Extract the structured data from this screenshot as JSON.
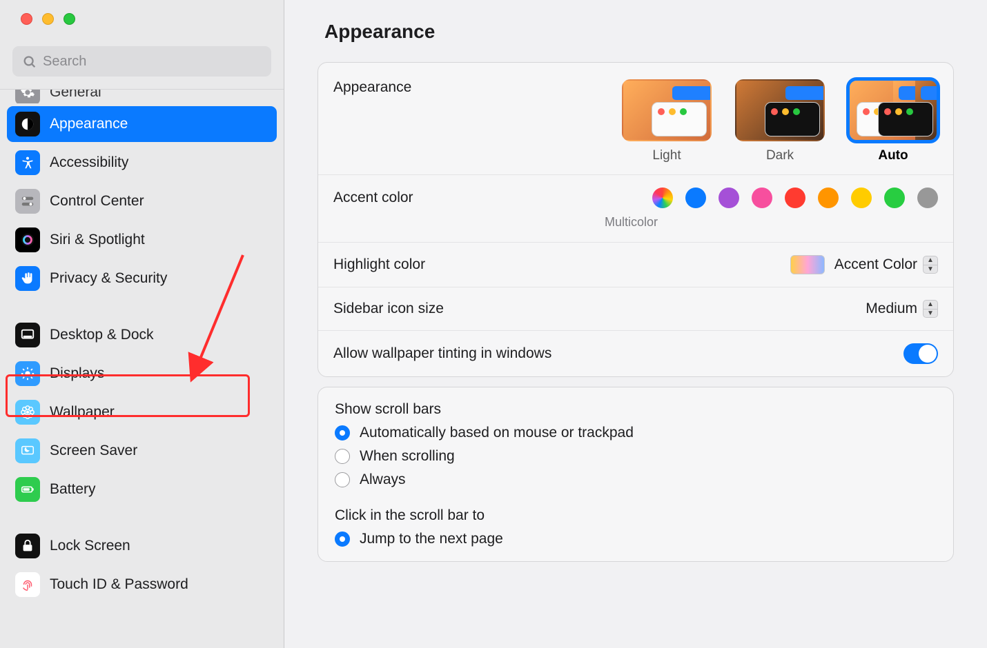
{
  "window": {
    "search_placeholder": "Search"
  },
  "sidebar": {
    "items": [
      {
        "id": "sb-general",
        "label": "General",
        "icon": "gear",
        "bg": "#8e8e93",
        "cut": true
      },
      {
        "id": "sb-appearance",
        "label": "Appearance",
        "icon": "appearance",
        "bg": "#111111",
        "selected": true
      },
      {
        "id": "sb-accessibility",
        "label": "Accessibility",
        "icon": "accessibility",
        "bg": "#0a7aff"
      },
      {
        "id": "sb-controlcenter",
        "label": "Control Center",
        "icon": "switches",
        "bg": "#b7b7bc"
      },
      {
        "id": "sb-siri",
        "label": "Siri & Spotlight",
        "icon": "siri",
        "bg": "#000"
      },
      {
        "id": "sb-privacy",
        "label": "Privacy & Security",
        "icon": "hand",
        "bg": "#0a7aff"
      },
      {
        "sep": true
      },
      {
        "id": "sb-desktopdock",
        "label": "Desktop & Dock",
        "icon": "dock",
        "bg": "#111111",
        "annotated": true
      },
      {
        "id": "sb-displays",
        "label": "Displays",
        "icon": "sun",
        "bg": "#2f9bff"
      },
      {
        "id": "sb-wallpaper",
        "label": "Wallpaper",
        "icon": "flower",
        "bg": "#5ac8ff"
      },
      {
        "id": "sb-screensaver",
        "label": "Screen Saver",
        "icon": "moon",
        "bg": "#5ac8ff"
      },
      {
        "id": "sb-battery",
        "label": "Battery",
        "icon": "battery",
        "bg": "#2ecc4e"
      },
      {
        "sep": true
      },
      {
        "id": "sb-lockscreen",
        "label": "Lock Screen",
        "icon": "lock",
        "bg": "#111111"
      },
      {
        "id": "sb-touchid",
        "label": "Touch ID & Password",
        "icon": "fingerprint",
        "bg": "#ffffff",
        "fg": "#ff5b6f"
      }
    ]
  },
  "page": {
    "title": "Appearance",
    "appearance": {
      "label": "Appearance",
      "options": [
        {
          "label": "Light",
          "selected": false
        },
        {
          "label": "Dark",
          "selected": false
        },
        {
          "label": "Auto",
          "selected": true
        }
      ]
    },
    "accent": {
      "label": "Accent color",
      "selected_name": "Multicolor",
      "colors": [
        {
          "name": "Multicolor",
          "css": "multi",
          "selected": true
        },
        {
          "name": "Blue",
          "css": "#0a7aff"
        },
        {
          "name": "Purple",
          "css": "#a550d7"
        },
        {
          "name": "Pink",
          "css": "#f74f9e"
        },
        {
          "name": "Red",
          "css": "#ff3b30"
        },
        {
          "name": "Orange",
          "css": "#ff9500"
        },
        {
          "name": "Yellow",
          "css": "#ffcc00"
        },
        {
          "name": "Green",
          "css": "#28cd41"
        },
        {
          "name": "Graphite",
          "css": "#989898"
        }
      ]
    },
    "highlight": {
      "label": "Highlight color",
      "value": "Accent Color"
    },
    "sidebar_size": {
      "label": "Sidebar icon size",
      "value": "Medium"
    },
    "wallpaper_tint": {
      "label": "Allow wallpaper tinting in windows",
      "on": true
    },
    "scrollbars": {
      "title": "Show scroll bars",
      "options": [
        {
          "label": "Automatically based on mouse or trackpad",
          "selected": true
        },
        {
          "label": "When scrolling"
        },
        {
          "label": "Always"
        }
      ]
    },
    "click_scroll": {
      "title": "Click in the scroll bar to",
      "options": [
        {
          "label": "Jump to the next page",
          "selected": true
        }
      ]
    }
  },
  "annotation": {
    "target": "sb-desktopdock"
  }
}
